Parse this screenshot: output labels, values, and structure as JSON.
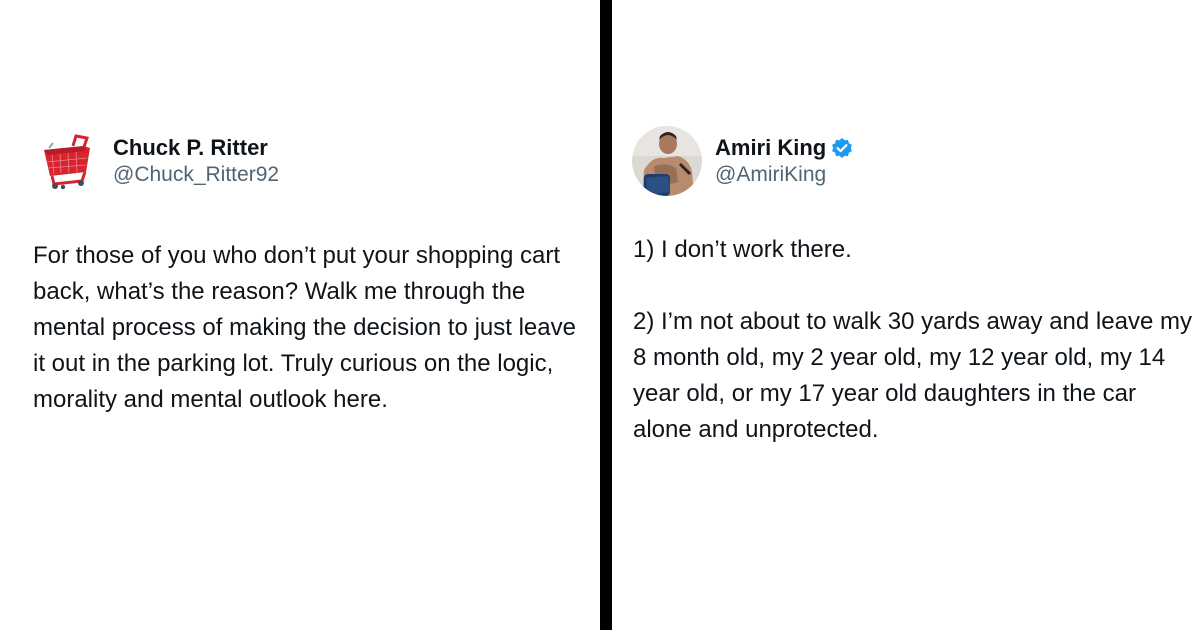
{
  "tweets": [
    {
      "author": {
        "name": "Chuck P. Ritter",
        "handle": "@Chuck_Ritter92",
        "avatar_icon": "shopping-cart-icon",
        "verified": false
      },
      "paragraphs": [
        "For those of you who don’t put your shopping cart back, what’s the reason? Walk me through the mental process of making the decision to just leave it out in the parking lot. Truly curious on the logic, morality and mental outlook here."
      ]
    },
    {
      "author": {
        "name": "Amiri King",
        "handle": "@AmiriKing",
        "avatar_icon": "profile-photo",
        "verified": true,
        "verified_icon": "verified-badge-icon"
      },
      "paragraphs": [
        "1) I don’t work there.",
        "2) I’m not about to walk 30 yards away and leave my 8 month old, my 2 year old, my 12 year old, my 14 year old, or my 17 year old daughters in the car alone and unprotected."
      ]
    }
  ],
  "colors": {
    "text": "#0f1419",
    "handle": "#536471",
    "divider": "#000000",
    "verified": "#1d9bf0",
    "cart_red": "#d9232e"
  }
}
